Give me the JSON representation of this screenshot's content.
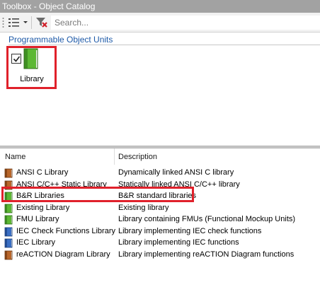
{
  "window": {
    "title": "Toolbox - Object Catalog"
  },
  "toolbar": {
    "view_icon": "list-view-icon",
    "filter_icon": "filter-clear-icon",
    "search_placeholder": "Search..."
  },
  "group": {
    "title": "Programmable Object Units",
    "tile": {
      "label": "Library",
      "checked": true,
      "icon": "green-book-icon"
    }
  },
  "table": {
    "columns": [
      "Name",
      "Description"
    ],
    "rows": [
      {
        "name": "ANSI C Library",
        "description": "Dynamically linked ANSI C library",
        "icon": "brown-book-icon"
      },
      {
        "name": "ANSI C/C++ Static Library",
        "description": "Statically linked ANSI C/C++ library",
        "icon": "brown-book-icon"
      },
      {
        "name": "B&R Libraries",
        "description": "B&R standard libraries",
        "icon": "green-book-icon"
      },
      {
        "name": "Existing Library",
        "description": "Existing library",
        "icon": "green-book-icon"
      },
      {
        "name": "FMU Library",
        "description": "Library containing FMUs (Functional Mockup Units)",
        "icon": "green-book-icon"
      },
      {
        "name": "IEC Check Functions Library",
        "description": "Library implementing IEC check functions",
        "icon": "blue-book-icon"
      },
      {
        "name": "IEC Library",
        "description": "Library implementing IEC functions",
        "icon": "blue-book-icon"
      },
      {
        "name": "reACTION Diagram Library",
        "description": "Library implementing reACTION Diagram functions",
        "icon": "brown-book-icon"
      }
    ]
  },
  "colors": {
    "highlight": "#e0212b",
    "group_title": "#1e5aa8",
    "title_bar": "#a2a2a2",
    "book_green": "#5cb833",
    "book_brown": "#b8662a",
    "book_blue": "#3a6fc4"
  }
}
